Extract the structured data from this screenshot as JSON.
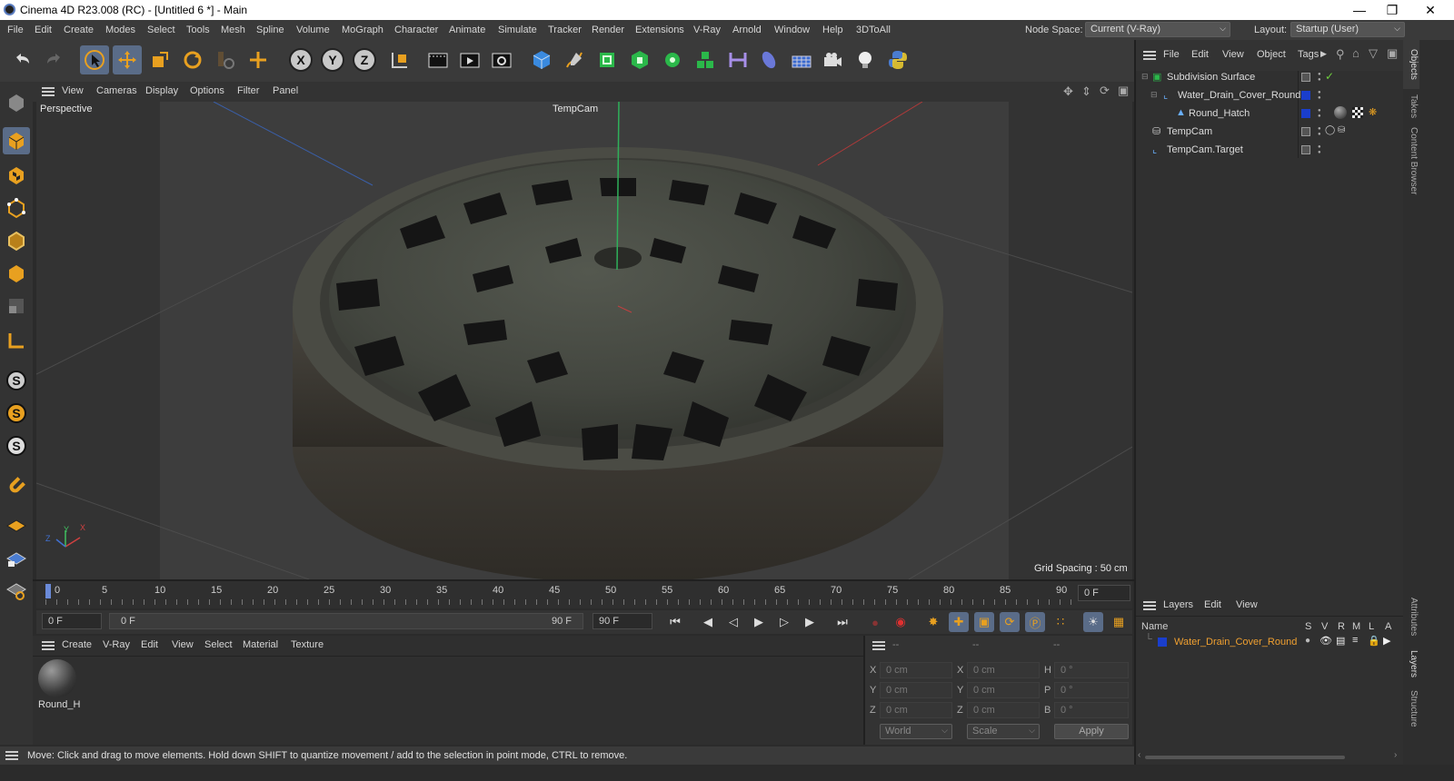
{
  "window": {
    "title": "Cinema 4D R23.008 (RC) - [Untitled 6 *] - Main"
  },
  "menu": {
    "items": [
      "File",
      "Edit",
      "Create",
      "Modes",
      "Select",
      "Tools",
      "Mesh",
      "Spline",
      "Volume",
      "MoGraph",
      "Character",
      "Animate",
      "Simulate",
      "Tracker",
      "Render",
      "Extensions",
      "V-Ray",
      "Arnold",
      "Window",
      "Help",
      "3DToAll"
    ]
  },
  "nodespace": {
    "label": "Node Space:",
    "value": "Current (V-Ray)"
  },
  "layout": {
    "label": "Layout:",
    "value": "Startup (User)"
  },
  "toolbar": {
    "axis_x": "X",
    "axis_y": "Y",
    "axis_z": "Z"
  },
  "viewport": {
    "menu": [
      "View",
      "Cameras",
      "Display",
      "Options",
      "Filter",
      "Panel"
    ],
    "mode": "Perspective",
    "camera": "TempCam",
    "grid_spacing": "Grid Spacing : 50 cm",
    "axis_labels": {
      "x": "X",
      "y": "Y",
      "z": "Z"
    }
  },
  "timeline": {
    "ticks": [
      "0",
      "5",
      "10",
      "15",
      "20",
      "25",
      "30",
      "35",
      "40",
      "45",
      "50",
      "55",
      "60",
      "65",
      "70",
      "75",
      "80",
      "85",
      "90"
    ],
    "current_frame": "0 F",
    "start_frame": "0 F",
    "range_start": "0 F",
    "range_end": "90 F",
    "end_frame": "90 F"
  },
  "material": {
    "menu": [
      "Create",
      "V-Ray",
      "Edit",
      "View",
      "Select",
      "Material",
      "Texture"
    ],
    "items": [
      {
        "name": "Round_H"
      }
    ]
  },
  "coords": {
    "headers": [
      "--",
      "--",
      "--"
    ],
    "rows": [
      {
        "a_label": "X",
        "a_val": "0 cm",
        "b_label": "X",
        "b_val": "0 cm",
        "c_label": "H",
        "c_val": "0 °"
      },
      {
        "a_label": "Y",
        "a_val": "0 cm",
        "b_label": "Y",
        "b_val": "0 cm",
        "c_label": "P",
        "c_val": "0 °"
      },
      {
        "a_label": "Z",
        "a_val": "0 cm",
        "b_label": "Z",
        "b_val": "0 cm",
        "c_label": "B",
        "c_val": "0 °"
      }
    ],
    "space": "World",
    "mode": "Scale",
    "apply": "Apply"
  },
  "objects": {
    "menu": [
      "File",
      "Edit",
      "View",
      "Object",
      "Tags"
    ],
    "items": [
      {
        "name": "Subdivision Surface"
      },
      {
        "name": "Water_Drain_Cover_Round"
      },
      {
        "name": "Round_Hatch"
      },
      {
        "name": "TempCam"
      },
      {
        "name": "TempCam.Target"
      }
    ]
  },
  "layers": {
    "menu": [
      "Layers",
      "Edit",
      "View"
    ],
    "columns": [
      "Name",
      "S",
      "V",
      "R",
      "M",
      "L",
      "A"
    ],
    "items": [
      {
        "name": "Water_Drain_Cover_Round",
        "color": "#1a3ecc"
      }
    ]
  },
  "right_tabs": [
    "Objects",
    "Takes",
    "Content Browser",
    "Attributes",
    "Layers",
    "Structure"
  ],
  "status": "Move: Click and drag to move elements. Hold down SHIFT to quantize movement / add to the selection in point mode, CTRL to remove.",
  "colors": {
    "accent_select": "#5a6c88",
    "layer_text": "#f0a030",
    "layer_blue": "#1a3ecc"
  }
}
